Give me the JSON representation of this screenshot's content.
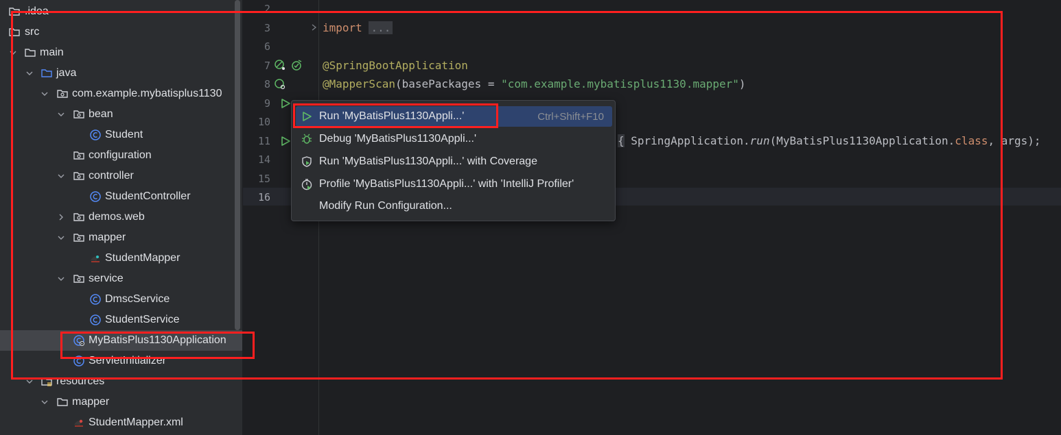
{
  "project_tree": {
    "items": [
      {
        "label": ".idea",
        "icon": "folder-icon",
        "expanded": false
      },
      {
        "label": "src",
        "icon": "folder-icon",
        "expanded": true
      },
      {
        "label": "main",
        "icon": "folder-icon",
        "expanded": true
      },
      {
        "label": "java",
        "icon": "source-folder-icon",
        "expanded": true
      },
      {
        "label": "com.example.mybatisplus1130",
        "icon": "package-icon",
        "expanded": true
      },
      {
        "label": "bean",
        "icon": "package-icon",
        "expanded": true
      },
      {
        "label": "Student",
        "icon": "class-icon"
      },
      {
        "label": "configuration",
        "icon": "package-icon"
      },
      {
        "label": "controller",
        "icon": "package-icon",
        "expanded": true
      },
      {
        "label": "StudentController",
        "icon": "class-icon"
      },
      {
        "label": "demos.web",
        "icon": "package-icon",
        "expanded": false
      },
      {
        "label": "mapper",
        "icon": "package-icon",
        "expanded": true
      },
      {
        "label": "StudentMapper",
        "icon": "mybatis-mapper-icon"
      },
      {
        "label": "service",
        "icon": "package-icon",
        "expanded": true
      },
      {
        "label": "DmscService",
        "icon": "class-icon"
      },
      {
        "label": "StudentService",
        "icon": "class-icon"
      },
      {
        "label": "MyBatisPlus1130Application",
        "icon": "spring-boot-class-icon",
        "selected": true
      },
      {
        "label": "ServletInitializer",
        "icon": "class-icon"
      },
      {
        "label": "resources",
        "icon": "resources-folder-icon",
        "expanded": true
      },
      {
        "label": "mapper",
        "icon": "folder-icon",
        "expanded": true
      },
      {
        "label": "StudentMapper.xml",
        "icon": "mybatis-xml-icon"
      }
    ]
  },
  "editor": {
    "line_numbers": [
      "2",
      "3",
      "6",
      "7",
      "8",
      "9",
      "10",
      "11",
      "14",
      "15",
      "16"
    ],
    "current_line": "16",
    "code": {
      "import_kw": "import",
      "import_fold": "...",
      "annotation_1": "@SpringBootApplication",
      "annotation_2": "@MapperScan",
      "mapperscan_args_open": "(basePackages = ",
      "mapperscan_string": "\"com.example.mybatisplus1130.mapper\"",
      "mapperscan_args_close": ")",
      "line11_brace": "{",
      "line11_call_a": " SpringApplication.",
      "line11_run": "run",
      "line11_call_b": "(MyBatisPlus1130Application.",
      "line11_class_kw": "class",
      "line11_call_c": ", args);"
    }
  },
  "run_menu": {
    "items": [
      {
        "label": "Run 'MyBatisPlus1130Appli...'",
        "shortcut": "Ctrl+Shift+F10",
        "icon": "run-icon"
      },
      {
        "label": "Debug 'MyBatisPlus1130Appli...'",
        "icon": "debug-icon"
      },
      {
        "label": "Run 'MyBatisPlus1130Appli...' with Coverage",
        "icon": "coverage-icon"
      },
      {
        "label": "Profile 'MyBatisPlus1130Appli...' with 'IntelliJ Profiler'",
        "icon": "profiler-icon"
      },
      {
        "label": "Modify Run Configuration...",
        "icon": ""
      }
    ]
  },
  "colors": {
    "accent": "#2e436e",
    "highlight": "#ff1f1f",
    "run_green": "#5fb865"
  }
}
